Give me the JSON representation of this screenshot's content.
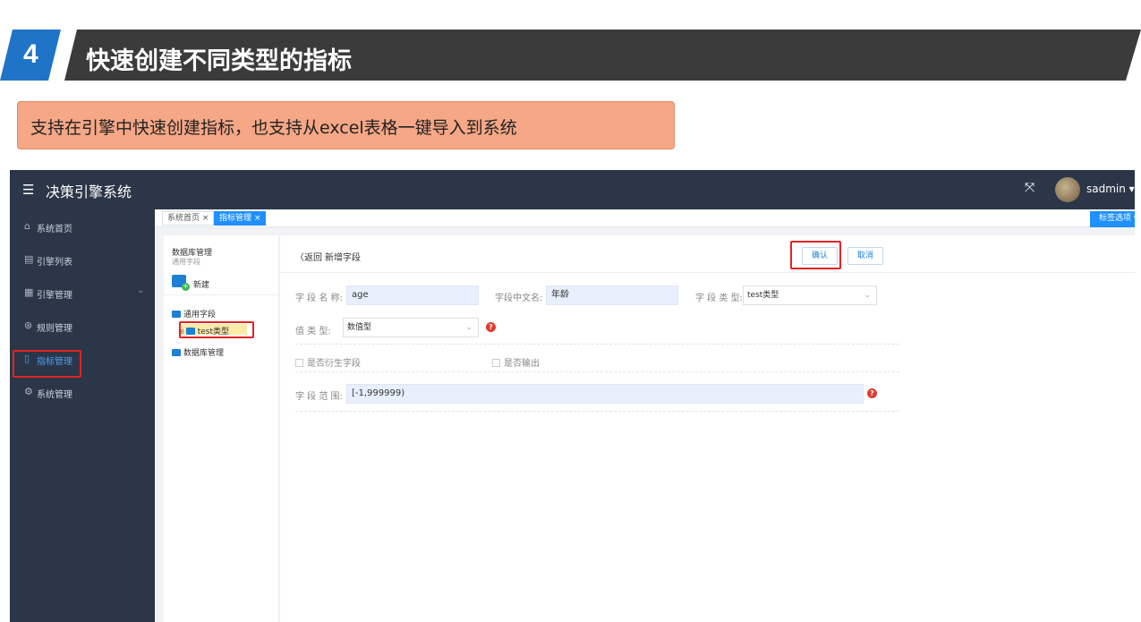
{
  "banner": {
    "number": "4",
    "title": "快速创建不同类型的指标"
  },
  "callout": {
    "text": "支持在引擎中快速创建指标，也支持从excel表格一键导入到系统"
  },
  "app": {
    "menu_icon": "hamburger-icon",
    "title": "决策引擎系统",
    "user": "sadmin ▾",
    "colors": {
      "topbar": "#2b3648",
      "accent": "#1e90ff",
      "highlight": "#e42323"
    }
  },
  "sidebar": {
    "items": [
      {
        "icon": "home-icon",
        "label": "系统首页"
      },
      {
        "icon": "list-icon",
        "label": "引擎列表"
      },
      {
        "icon": "grid-icon",
        "label": "引擎管理"
      },
      {
        "icon": "rule-icon",
        "label": "规则管理"
      },
      {
        "icon": "book-icon",
        "label": "指标管理"
      },
      {
        "icon": "settings-icon",
        "label": "系统管理"
      }
    ]
  },
  "tabs": [
    {
      "label": "系统首页 ×"
    },
    {
      "label": "指标管理 ×"
    }
  ],
  "tab_options": "标签选项 ▾",
  "tree": {
    "title": "数据库管理",
    "subtitle": "通用字段",
    "new_label": "新建",
    "nodes": [
      "通用字段",
      "test类型",
      "数据库管理"
    ],
    "expand_glyph": "⊞"
  },
  "form": {
    "back_label": "〈返回",
    "page_title": "新增字段",
    "confirm_label": "确认",
    "cancel_label": "取消",
    "field_name_label": "字 段 名 称:",
    "field_name_value": "age",
    "cn_name_label": "字段中文名:",
    "cn_name_value": "年龄",
    "field_type_label": "字 段 类 型:",
    "field_type_value": "test类型",
    "value_type_label": "值   类   型:",
    "value_type_value": "数值型",
    "derived_label": "是否衍生字段",
    "output_label": "是否输出",
    "range_label": "字 段 范 围:",
    "range_value": "[-1,999999)",
    "help_glyph": "?"
  }
}
